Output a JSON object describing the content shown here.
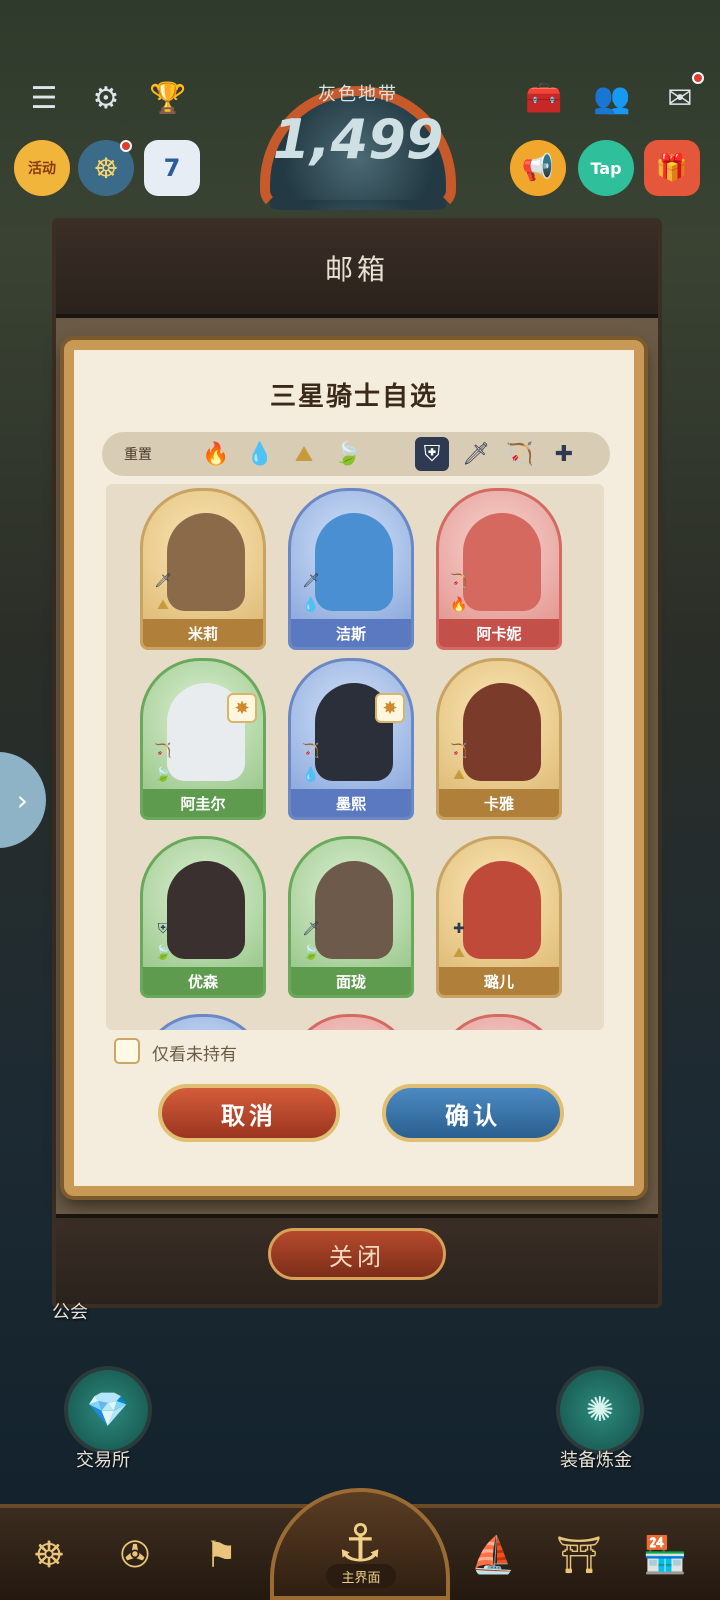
{
  "hud": {
    "rank_title": "灰色地带",
    "rank_value": "1,499",
    "activity_label": "活动",
    "calendar_day": "7",
    "tap_label": "Tap"
  },
  "mailbox": {
    "title": "邮箱",
    "close_label": "关闭"
  },
  "dialog": {
    "title": "三星骑士自选",
    "reset_label": "重置",
    "filters": {
      "elements": [
        "fire",
        "water",
        "earth",
        "wind"
      ],
      "roles": [
        "tank",
        "sword",
        "bow",
        "heal"
      ]
    },
    "owned_only_label": "仅看未持有",
    "cancel_label": "取消",
    "confirm_label": "确认",
    "knights": [
      {
        "name": "米莉",
        "frame": "gold",
        "role": "sword",
        "element": "earth"
      },
      {
        "name": "洁斯",
        "frame": "blue",
        "role": "sword",
        "element": "water"
      },
      {
        "name": "阿卡妮",
        "frame": "red",
        "role": "bow",
        "element": "fire"
      },
      {
        "name": "阿圭尔",
        "frame": "green",
        "role": "bow",
        "element": "wind"
      },
      {
        "name": "墨熙",
        "frame": "blue",
        "role": "bow",
        "element": "water"
      },
      {
        "name": "卡雅",
        "frame": "gold",
        "role": "bow",
        "element": "earth"
      },
      {
        "name": "优森",
        "frame": "green",
        "role": "tank",
        "element": "wind"
      },
      {
        "name": "面珑",
        "frame": "green",
        "role": "sword",
        "element": "wind"
      },
      {
        "name": "璐儿",
        "frame": "gold",
        "role": "heal",
        "element": "earth"
      }
    ]
  },
  "bottom": {
    "guild_label": "公会",
    "exchange_label": "交易所",
    "alchemy_label": "装备炼金",
    "home_label": "主界面"
  },
  "colors": {
    "frame_gold": "#c89a55",
    "cancel_red": "#c2472a",
    "confirm_blue": "#3f7db6"
  }
}
